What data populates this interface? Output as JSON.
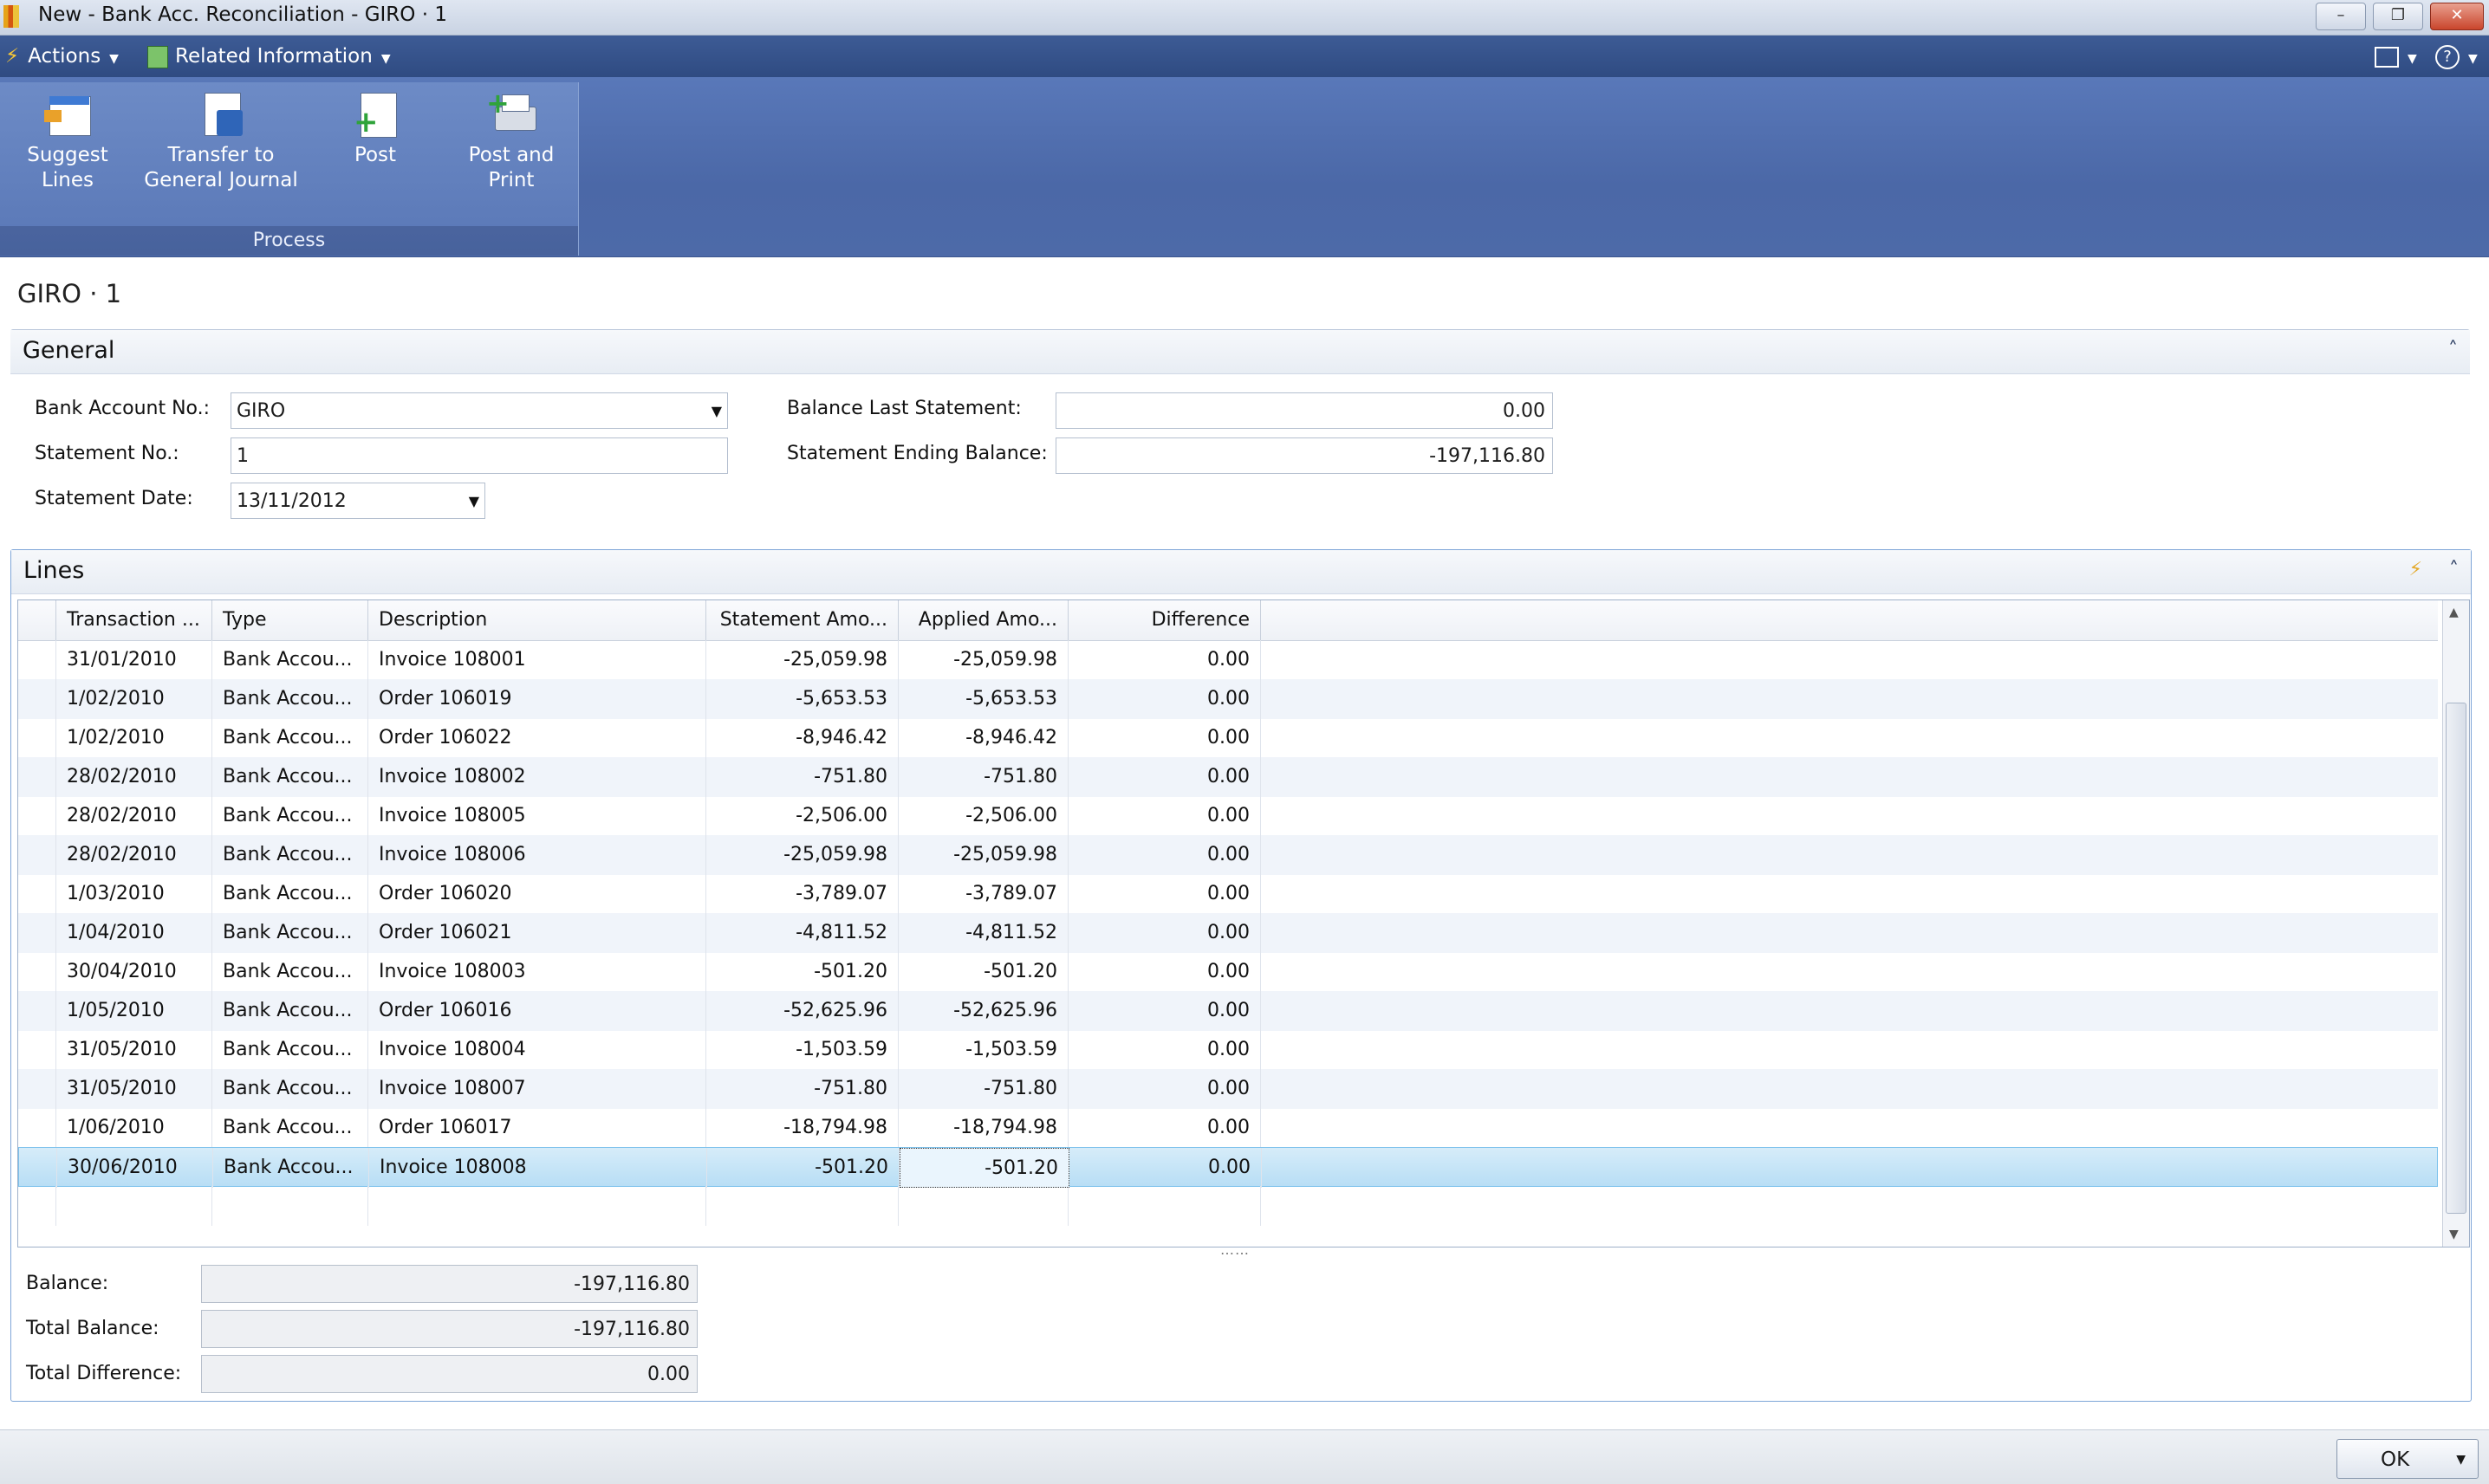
{
  "window": {
    "title": "New - Bank Acc. Reconciliation - GIRO · 1"
  },
  "menu": {
    "actions": "Actions",
    "related": "Related Information"
  },
  "ribbon": {
    "suggest_line1": "Suggest",
    "suggest_line2": "Lines",
    "transfer_line1": "Transfer to",
    "transfer_line2": "General Journal",
    "post": "Post",
    "postprint_line1": "Post and",
    "postprint_line2": "Print",
    "group": "Process"
  },
  "page": {
    "title": "GIRO · 1"
  },
  "general": {
    "header": "General",
    "bank_account_label": "Bank Account No.:",
    "bank_account_value": "GIRO",
    "statement_no_label": "Statement No.:",
    "statement_no_value": "1",
    "statement_date_label": "Statement Date:",
    "statement_date_value": "13/11/2012",
    "balance_last_label": "Balance Last Statement:",
    "balance_last_value": "0.00",
    "ending_balance_label": "Statement Ending Balance:",
    "ending_balance_value": "-197,116.80"
  },
  "lines": {
    "header": "Lines",
    "columns": [
      "Transaction ...",
      "Type",
      "Description",
      "Statement Amo...",
      "Applied Amo...",
      "Difference"
    ],
    "rows": [
      [
        "31/01/2010",
        "Bank Accou...",
        "Invoice 108001",
        "-25,059.98",
        "-25,059.98",
        "0.00"
      ],
      [
        "1/02/2010",
        "Bank Accou...",
        "Order 106019",
        "-5,653.53",
        "-5,653.53",
        "0.00"
      ],
      [
        "1/02/2010",
        "Bank Accou...",
        "Order 106022",
        "-8,946.42",
        "-8,946.42",
        "0.00"
      ],
      [
        "28/02/2010",
        "Bank Accou...",
        "Invoice 108002",
        "-751.80",
        "-751.80",
        "0.00"
      ],
      [
        "28/02/2010",
        "Bank Accou...",
        "Invoice 108005",
        "-2,506.00",
        "-2,506.00",
        "0.00"
      ],
      [
        "28/02/2010",
        "Bank Accou...",
        "Invoice 108006",
        "-25,059.98",
        "-25,059.98",
        "0.00"
      ],
      [
        "1/03/2010",
        "Bank Accou...",
        "Order 106020",
        "-3,789.07",
        "-3,789.07",
        "0.00"
      ],
      [
        "1/04/2010",
        "Bank Accou...",
        "Order 106021",
        "-4,811.52",
        "-4,811.52",
        "0.00"
      ],
      [
        "30/04/2010",
        "Bank Accou...",
        "Invoice 108003",
        "-501.20",
        "-501.20",
        "0.00"
      ],
      [
        "1/05/2010",
        "Bank Accou...",
        "Order 106016",
        "-52,625.96",
        "-52,625.96",
        "0.00"
      ],
      [
        "31/05/2010",
        "Bank Accou...",
        "Invoice 108004",
        "-1,503.59",
        "-1,503.59",
        "0.00"
      ],
      [
        "31/05/2010",
        "Bank Accou...",
        "Invoice 108007",
        "-751.80",
        "-751.80",
        "0.00"
      ],
      [
        "1/06/2010",
        "Bank Accou...",
        "Order 106017",
        "-18,794.98",
        "-18,794.98",
        "0.00"
      ],
      [
        "30/06/2010",
        "Bank Accou...",
        "Invoice 108008",
        "-501.20",
        "-501.20",
        "0.00"
      ]
    ],
    "selected_row": 13
  },
  "totals": {
    "balance_label": "Balance:",
    "balance_value": "-197,116.80",
    "total_balance_label": "Total Balance:",
    "total_balance_value": "-197,116.80",
    "total_difference_label": "Total Difference:",
    "total_difference_value": "0.00"
  },
  "status": {
    "ok": "OK"
  },
  "colors": {
    "ribbon": "#5270b0",
    "menubar": "#34508a",
    "selected_row": "#c4e4f7"
  }
}
